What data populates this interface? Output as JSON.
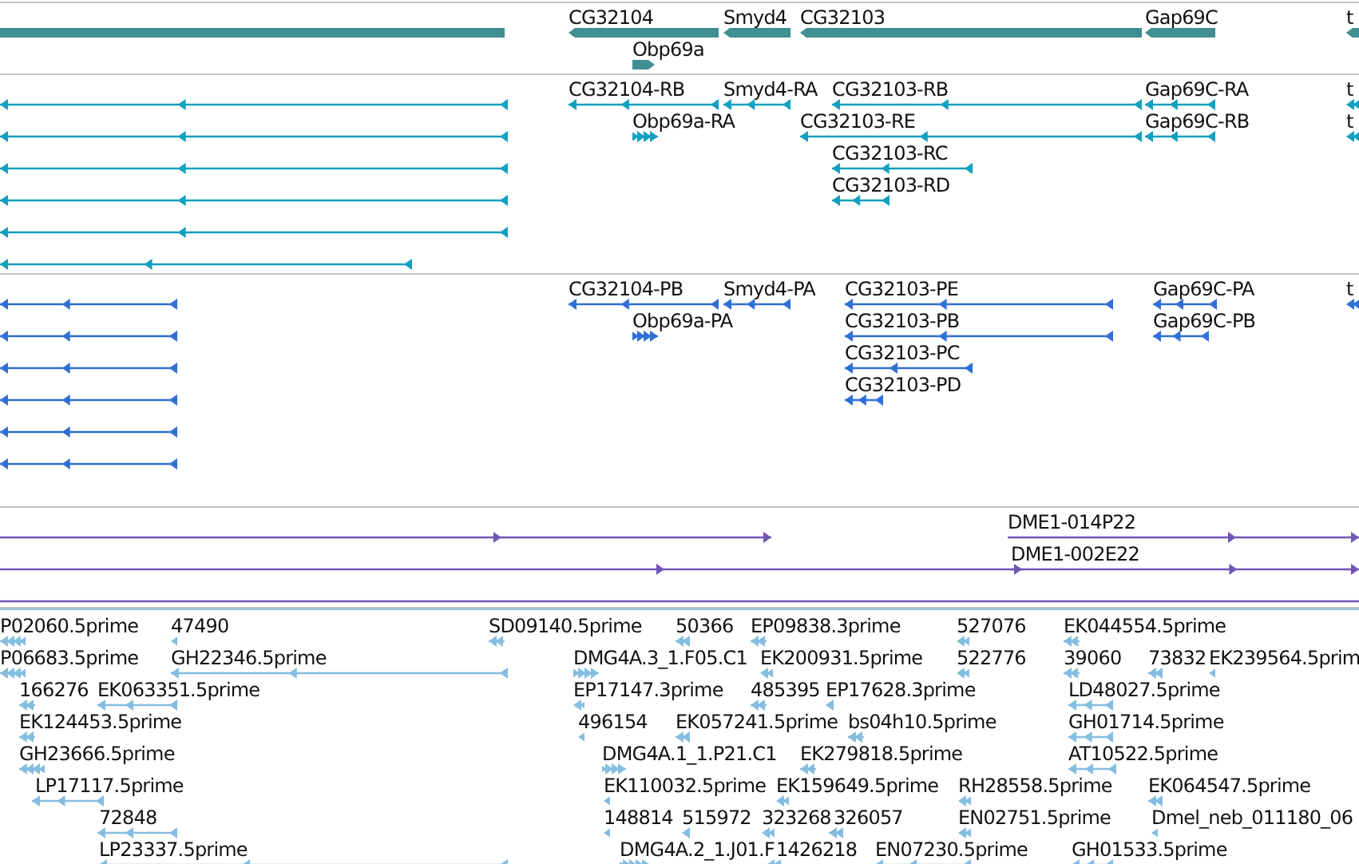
{
  "tracks": [
    {
      "kind": "gene",
      "features": [
        {
          "label": "CG32104"
        },
        {
          "label": "Smyd4"
        },
        {
          "label": "CG32103"
        },
        {
          "label": "Gap69C"
        },
        {
          "label": "t"
        },
        {
          "label": "Obp69a"
        }
      ]
    },
    {
      "kind": "transcript",
      "features": [
        {
          "label": "CG32104-RB"
        },
        {
          "label": "Smyd4-RA"
        },
        {
          "label": "CG32103-RB"
        },
        {
          "label": "Gap69C-RA"
        },
        {
          "label": "t"
        },
        {
          "label": "Obp69a-RA"
        },
        {
          "label": "CG32103-RE"
        },
        {
          "label": "Gap69C-RB"
        },
        {
          "label": "t"
        },
        {
          "label": "CG32103-RC"
        },
        {
          "label": "CG32103-RD"
        }
      ]
    },
    {
      "kind": "protein",
      "features": [
        {
          "label": "CG32104-PB"
        },
        {
          "label": "Smyd4-PA"
        },
        {
          "label": "CG32103-PE"
        },
        {
          "label": "Gap69C-PA"
        },
        {
          "label": "t"
        },
        {
          "label": "Obp69a-PA"
        },
        {
          "label": "CG32103-PB"
        },
        {
          "label": "Gap69C-PB"
        },
        {
          "label": "CG32103-PC"
        },
        {
          "label": "CG32103-PD"
        }
      ]
    },
    {
      "kind": "clone",
      "features": [
        {
          "label": "DME1-014P22"
        },
        {
          "label": "DME1-002E22"
        }
      ]
    },
    {
      "kind": "est",
      "features": [
        {
          "label": "P02060.5prime"
        },
        {
          "label": "47490"
        },
        {
          "label": "SD09140.5prime"
        },
        {
          "label": "50366"
        },
        {
          "label": "EP09838.3prime"
        },
        {
          "label": "527076"
        },
        {
          "label": "EK044554.5prime"
        },
        {
          "label": "P06683.5prime"
        },
        {
          "label": "GH22346.5prime"
        },
        {
          "label": "DMG4A.3_1.F05.C1"
        },
        {
          "label": "EK200931.5prime"
        },
        {
          "label": "522776"
        },
        {
          "label": "39060"
        },
        {
          "label": "73832"
        },
        {
          "label": "EK239564.5prim"
        },
        {
          "label": "166276"
        },
        {
          "label": "EK063351.5prime"
        },
        {
          "label": "EP17147.3prime"
        },
        {
          "label": "485395"
        },
        {
          "label": "EP17628.3prime"
        },
        {
          "label": "LD48027.5prime"
        },
        {
          "label": "EK124453.5prime"
        },
        {
          "label": "496154"
        },
        {
          "label": "EK057241.5prime"
        },
        {
          "label": "bs04h10.5prime"
        },
        {
          "label": "GH01714.5prime"
        },
        {
          "label": "GH23666.5prime"
        },
        {
          "label": "DMG4A.1_1.P21.C1"
        },
        {
          "label": "EK279818.5prime"
        },
        {
          "label": "AT10522.5prime"
        },
        {
          "label": "LP17117.5prime"
        },
        {
          "label": "EK110032.5prime"
        },
        {
          "label": "EK159649.5prime"
        },
        {
          "label": "RH28558.5prime"
        },
        {
          "label": "EK064547.5prime"
        },
        {
          "label": "72848"
        },
        {
          "label": "148814"
        },
        {
          "label": "515972"
        },
        {
          "label": "323268"
        },
        {
          "label": "326057"
        },
        {
          "label": "EN02751.5prime"
        },
        {
          "label": "Dmel_neb_011180_06"
        },
        {
          "label": "LP23337.5prime"
        },
        {
          "label": "DMG4A.2_1.J01.F"
        },
        {
          "label": "1426218"
        },
        {
          "label": "EN07230.5prime"
        },
        {
          "label": "GH01533.5prime"
        }
      ]
    }
  ]
}
